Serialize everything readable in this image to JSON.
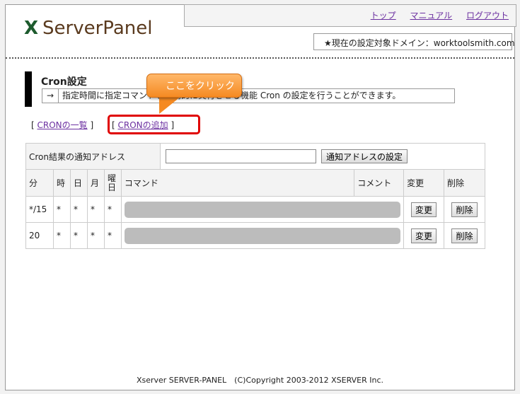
{
  "header": {
    "links": [
      "トップ",
      "マニュアル",
      "ログアウト"
    ],
    "logo_x": "X",
    "logo_text": "ServerPanel",
    "current_domain": "★現在の設定対象ドメイン：worktoolsmith.com"
  },
  "section": {
    "title": "Cron設定",
    "arrow": "→",
    "description": "指定時間に指定コマンドを自動的に実行させる機能 Cron の設定を行うことができます。"
  },
  "callout": "ここをクリック",
  "nav": {
    "list_label": "CRONの一覧",
    "add_label": "CRONの追加"
  },
  "notify": {
    "label": "Cron結果の通知アドレス",
    "input_value": "",
    "button": "通知アドレスの設定"
  },
  "table": {
    "headers": [
      "分",
      "時",
      "日",
      "月",
      "曜日",
      "コマンド",
      "コメント",
      "変更",
      "削除"
    ],
    "rows": [
      {
        "min": "*/15",
        "hour": "*",
        "day": "*",
        "month": "*",
        "dow": "*",
        "change": "変更",
        "delete": "削除"
      },
      {
        "min": "20",
        "hour": "*",
        "day": "*",
        "month": "*",
        "dow": "*",
        "change": "変更",
        "delete": "削除"
      }
    ]
  },
  "footer": "Xserver SERVER-PANEL　(C)Copyright 2003-2012 XSERVER Inc.",
  "colors": {
    "link": "#6b2fa0",
    "highlight_box": "#e00000",
    "callout": "#f58a22"
  }
}
